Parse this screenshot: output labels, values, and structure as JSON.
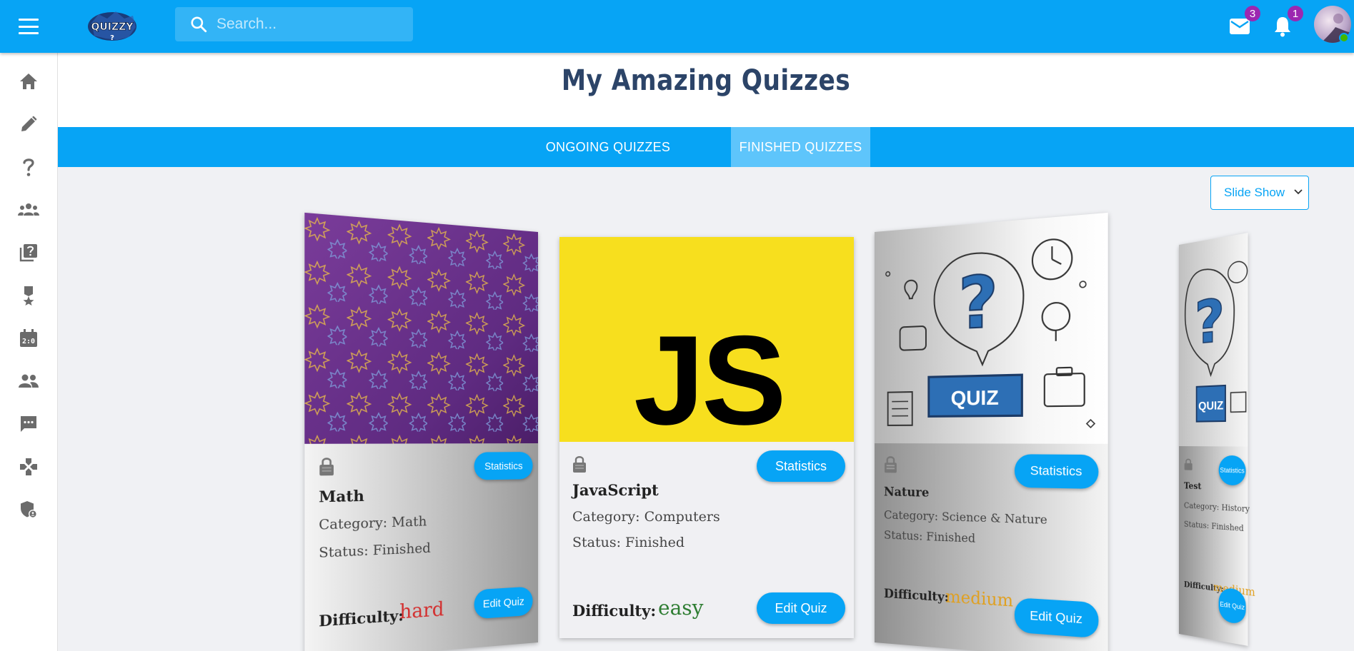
{
  "app": {
    "logo_text": "QUIZZY",
    "search_placeholder": "Search...",
    "mail_count": "3",
    "notification_count": "1"
  },
  "sidebar": {
    "items": [
      {
        "icon": "home-icon"
      },
      {
        "icon": "pencil-icon"
      },
      {
        "icon": "question-icon"
      },
      {
        "icon": "groups-icon"
      },
      {
        "icon": "quiz-library-icon"
      },
      {
        "icon": "medal-icon"
      },
      {
        "icon": "scoreboard-icon"
      },
      {
        "icon": "people-icon"
      },
      {
        "icon": "chat-icon"
      },
      {
        "icon": "gamepad-icon"
      },
      {
        "icon": "admin-shield-icon"
      }
    ]
  },
  "page": {
    "title": "My Amazing Quizzes"
  },
  "tabs": [
    {
      "label": "ONGOING QUIZZES",
      "active": false
    },
    {
      "label": "FINISHED QUIZZES",
      "active": true
    }
  ],
  "view_select": {
    "selected": "Slide Show"
  },
  "cards": [
    {
      "title": "Math",
      "category": "Category: Math",
      "status": "Status: Finished",
      "difficulty_label": "Difficulty:",
      "difficulty": "hard",
      "difficulty_color": "#d32f2f",
      "stats_label": "Statistics",
      "edit_label": "Edit Quiz"
    },
    {
      "title": "JavaScript",
      "category": "Category: Computers",
      "status": "Status: Finished",
      "difficulty_label": "Difficulty:",
      "difficulty": "easy",
      "difficulty_color": "#2e7d32",
      "stats_label": "Statistics",
      "edit_label": "Edit Quiz",
      "image_text": "JS"
    },
    {
      "title": "Nature",
      "category": "Category: Science & Nature",
      "status": "Status: Finished",
      "difficulty_label": "Difficulty:",
      "difficulty": "medium",
      "difficulty_color": "#e0a020",
      "stats_label": "Statistics",
      "edit_label": "Edit Quiz",
      "image_text": "QUIZ"
    },
    {
      "title": "Test",
      "category": "Category: History",
      "status": "Status: Finished",
      "difficulty_label": "Difficulty:",
      "difficulty": "medium",
      "difficulty_color": "#e0a020",
      "stats_label": "Statistics",
      "edit_label": "Edit Quiz",
      "image_text": "QUIZ"
    }
  ]
}
